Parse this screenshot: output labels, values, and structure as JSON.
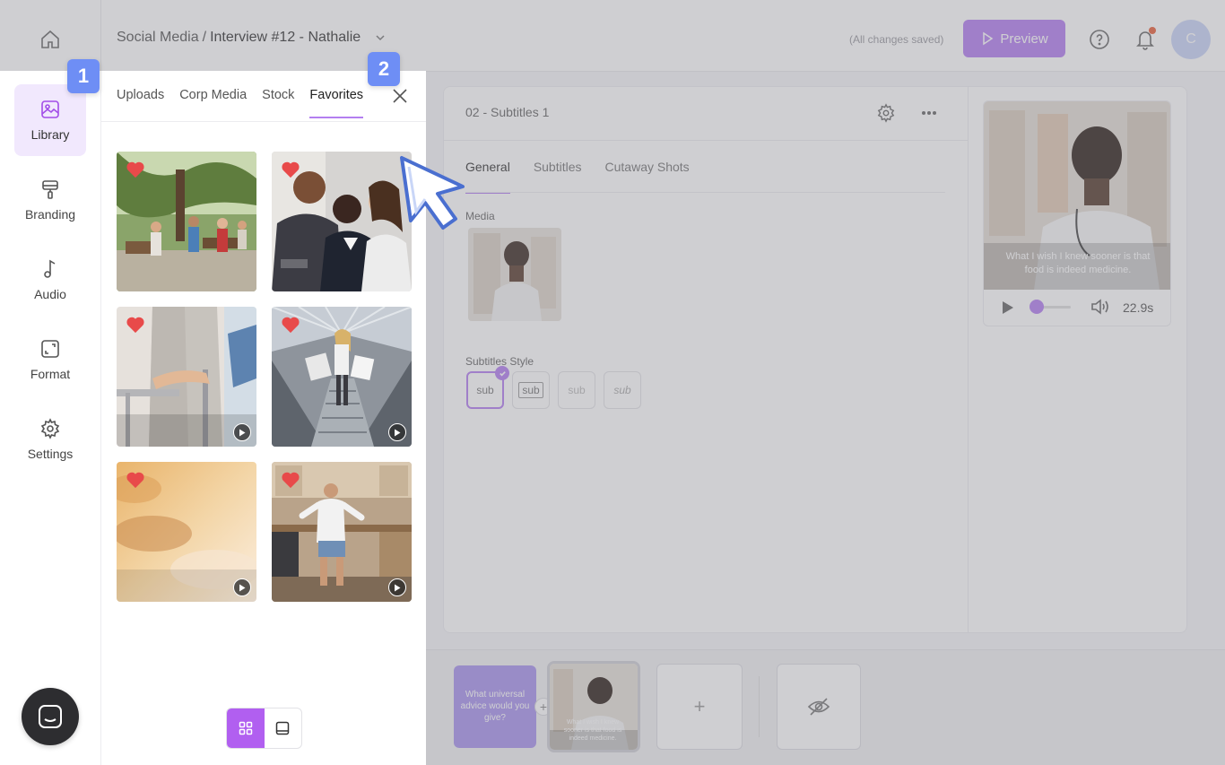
{
  "header": {
    "breadcrumb_parent": "Social Media",
    "breadcrumb_sep": "/",
    "breadcrumb_current": "Interview #12 - Nathalie",
    "save_status": "(All changes saved)",
    "preview_label": "Preview",
    "avatar_initial": "C"
  },
  "sidebar": {
    "items": [
      {
        "label": "Library",
        "icon": "image-icon",
        "active": true
      },
      {
        "label": "Branding",
        "icon": "paint-roller-icon"
      },
      {
        "label": "Audio",
        "icon": "music-note-icon"
      },
      {
        "label": "Format",
        "icon": "aspect-ratio-icon"
      },
      {
        "label": "Settings",
        "icon": "gear-icon"
      }
    ]
  },
  "library": {
    "tabs": [
      "Uploads",
      "Corp Media",
      "Stock",
      "Favorites"
    ],
    "active_tab": "Favorites",
    "items": [
      {
        "type": "image",
        "favorite": true,
        "scene": "outdoor-market"
      },
      {
        "type": "image",
        "favorite": true,
        "scene": "office-team"
      },
      {
        "type": "video",
        "favorite": true,
        "scene": "walker-assist"
      },
      {
        "type": "video",
        "favorite": true,
        "scene": "escalator-shopping"
      },
      {
        "type": "video",
        "favorite": true,
        "scene": "warm-blur"
      },
      {
        "type": "video",
        "favorite": true,
        "scene": "kitchen-dance"
      }
    ],
    "view_modes": [
      "grid",
      "single"
    ],
    "active_view": "grid"
  },
  "editor": {
    "scene_title": "02 - Subtitles 1",
    "tabs": [
      "General",
      "Subtitles",
      "Cutaway Shots"
    ],
    "active_tab": "General",
    "media_label": "Media",
    "subtitles_style_label": "Subtitles Style",
    "style_options": [
      "sub",
      "sub",
      "sub",
      "sub"
    ],
    "selected_style": 0
  },
  "video": {
    "caption": "What I wish I knew sooner is that food is indeed medicine.",
    "duration": "22.9s",
    "progress": 0.15
  },
  "timeline": {
    "scene1_text": "What universal advice would you give?",
    "scene2_caption": "What I wish I knew sooner is that food is indeed medicine.",
    "add_label": "+"
  },
  "annotations": {
    "marker1": "1",
    "marker2": "2"
  },
  "colors": {
    "accent": "#b37ff0",
    "accent_strong": "#b15ff0",
    "marker": "#6e8ef5",
    "heart": "#e84a4a"
  }
}
